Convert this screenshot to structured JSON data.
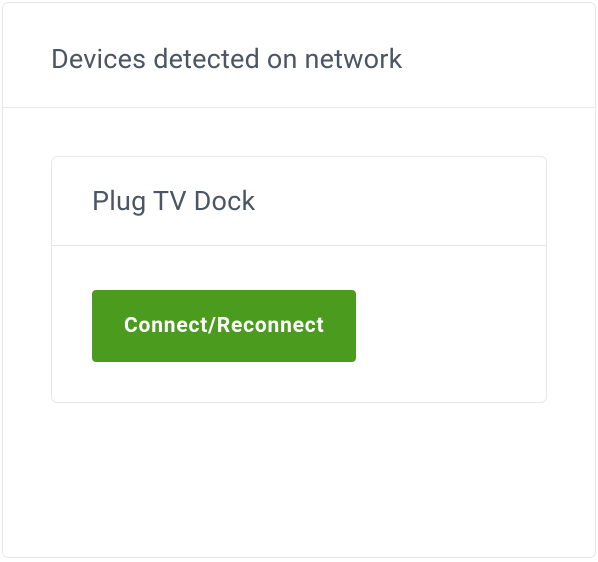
{
  "header": {
    "title": "Devices detected on network"
  },
  "devices": [
    {
      "name": "Plug TV Dock",
      "action_label": "Connect/Reconnect"
    }
  ]
}
